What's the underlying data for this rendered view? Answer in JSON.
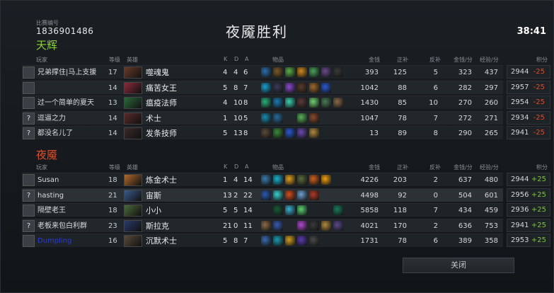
{
  "match": {
    "id_label": "比赛编号",
    "id": "1836901486",
    "result": "夜魇胜利",
    "duration": "38:41"
  },
  "headers": {
    "player": "玩家",
    "level": "等级",
    "hero": "英雄",
    "k": "K",
    "d": "D",
    "a": "A",
    "items": "物品",
    "gold": "金钱",
    "lh": "正补",
    "dn": "反补",
    "gpm": "金钱/分",
    "xpm": "经验/分",
    "mmr": "积分"
  },
  "radiant": {
    "name": "天辉",
    "players": [
      {
        "name": "兄弟撑住|马上支援",
        "avatar": "",
        "level": "17",
        "hero": "噬魂鬼",
        "k": "4",
        "d": "4",
        "a": "6",
        "gold": "393",
        "lh": "125",
        "dn": "5",
        "gpm": "323",
        "xpm": "437",
        "mmr": "2944",
        "delta": "-25"
      },
      {
        "name": "",
        "avatar": "",
        "level": "14",
        "hero": "痛苦女王",
        "k": "5",
        "d": "8",
        "a": "7",
        "gold": "1042",
        "lh": "88",
        "dn": "6",
        "gpm": "282",
        "xpm": "297",
        "mmr": "2957",
        "delta": "-25"
      },
      {
        "name": "过一个简单的夏天",
        "avatar": "",
        "level": "13",
        "hero": "瘟疫法师",
        "k": "4",
        "d": "10",
        "a": "8",
        "gold": "1430",
        "lh": "85",
        "dn": "10",
        "gpm": "270",
        "xpm": "260",
        "mmr": "2954",
        "delta": "-25"
      },
      {
        "name": "逗逼之力",
        "avatar": "?",
        "level": "14",
        "hero": "术士",
        "k": "1",
        "d": "10",
        "a": "5",
        "gold": "1047",
        "lh": "78",
        "dn": "7",
        "gpm": "272",
        "xpm": "271",
        "mmr": "2934",
        "delta": "-25"
      },
      {
        "name": "都没名儿了",
        "avatar": "?",
        "level": "14",
        "hero": "发条技师",
        "k": "5",
        "d": "13",
        "a": "8",
        "gold": "13",
        "lh": "89",
        "dn": "8",
        "gpm": "290",
        "xpm": "265",
        "mmr": "2941",
        "delta": "-25"
      }
    ]
  },
  "dire": {
    "name": "夜魇",
    "players": [
      {
        "name": "Susan",
        "avatar": "",
        "level": "18",
        "hero": "炼金术士",
        "k": "1",
        "d": "4",
        "a": "14",
        "gold": "4226",
        "lh": "203",
        "dn": "2",
        "gpm": "637",
        "xpm": "480",
        "mmr": "2944",
        "delta": "+25"
      },
      {
        "name": "hasting",
        "avatar": "?",
        "level": "21",
        "hero": "宙斯",
        "k": "13",
        "d": "2",
        "a": "22",
        "gold": "4498",
        "lh": "92",
        "dn": "0",
        "gpm": "504",
        "xpm": "601",
        "mmr": "2956",
        "delta": "+25"
      },
      {
        "name": "隔壁老王",
        "avatar": "",
        "level": "18",
        "hero": "小小",
        "k": "5",
        "d": "5",
        "a": "14",
        "gold": "5858",
        "lh": "118",
        "dn": "7",
        "gpm": "434",
        "xpm": "459",
        "mmr": "2936",
        "delta": "+25"
      },
      {
        "name": "老板来包白利群",
        "avatar": "?",
        "level": "23",
        "hero": "斯拉克",
        "k": "21",
        "d": "0",
        "a": "11",
        "gold": "4021",
        "lh": "170",
        "dn": "2",
        "gpm": "636",
        "xpm": "753",
        "mmr": "2941",
        "delta": "+25"
      },
      {
        "name": "Dumpling",
        "avatar": "",
        "level": "16",
        "hero": "沉默术士",
        "k": "5",
        "d": "8",
        "a": "7",
        "gold": "1731",
        "lh": "78",
        "dn": "6",
        "gpm": "389",
        "xpm": "358",
        "mmr": "2953",
        "delta": "+25"
      }
    ]
  },
  "close_label": "关闭",
  "colors": {
    "radiant": "#8ad13a",
    "dire": "#e0502a",
    "gold": "#e6b32a",
    "loss": "#e04a2a",
    "win": "#7ec634",
    "dumpling_name": "#2a3ae0"
  }
}
